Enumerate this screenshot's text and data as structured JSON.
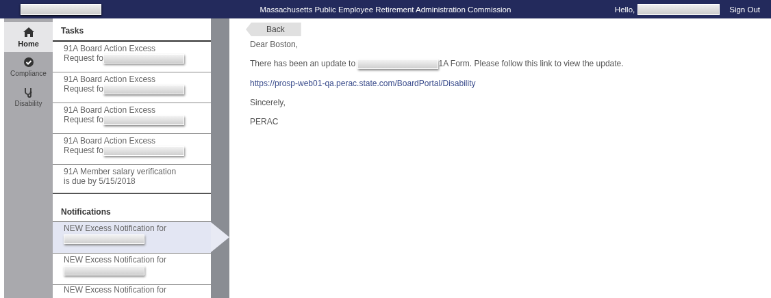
{
  "header": {
    "title": "Massachusetts Public Employee Retirement Administration Commission",
    "greeting": "Hello,",
    "sign_out": "Sign Out"
  },
  "nav": [
    {
      "label": "Home",
      "kind": "home",
      "selected": true
    },
    {
      "label": "Compliance",
      "kind": "check",
      "selected": false
    },
    {
      "label": "Disability",
      "kind": "stethoscope",
      "selected": false
    }
  ],
  "tasks": {
    "title": "Tasks",
    "items": [
      {
        "lines": [
          "91A Board Action Excess",
          "Request fo"
        ],
        "redacted": true
      },
      {
        "lines": [
          "91A Board Action Excess",
          "Request fo"
        ],
        "redacted": true
      },
      {
        "lines": [
          "91A Board Action Excess",
          "Request fo"
        ],
        "redacted": true
      },
      {
        "lines": [
          "91A Board Action Excess",
          "Request fo"
        ],
        "redacted": true
      },
      {
        "lines": [
          "91A Member salary verification",
          "is due by 5/15/2018"
        ],
        "redacted": false
      }
    ]
  },
  "notifications": {
    "title": "Notifications",
    "items": [
      {
        "text": "NEW Excess Notification for",
        "redacted": true,
        "selected": true
      },
      {
        "text": "NEW Excess Notification for",
        "redacted": true,
        "selected": false
      },
      {
        "text": "NEW Excess Notification for",
        "redacted": false,
        "selected": false
      }
    ]
  },
  "back": "Back",
  "message": [
    {
      "kind": "text",
      "text": "Dear Boston,"
    },
    {
      "kind": "redacted",
      "before": "There has been an update to",
      "after": "1A Form. Please follow this link to view the update."
    },
    {
      "kind": "link",
      "text": "https://prosp-web01-qa.perac.state.com/BoardPortal/Disability"
    },
    {
      "kind": "text",
      "text": "Sincerely,"
    },
    {
      "kind": "text",
      "text": "PERAC"
    }
  ]
}
